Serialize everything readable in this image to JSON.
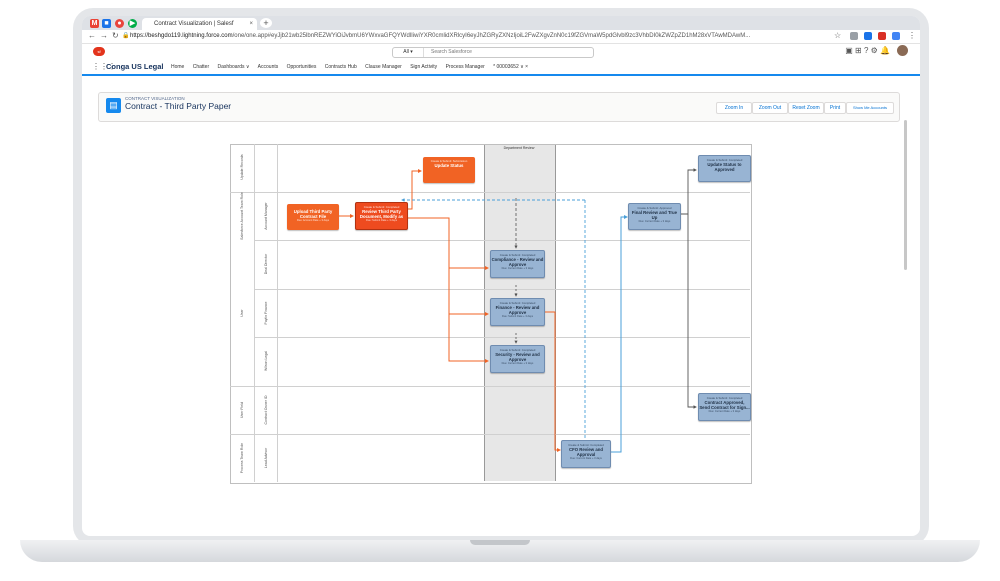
{
  "browser": {
    "tab_title": "Contract Visualization | Salesf",
    "tab_close": "×",
    "new_tab": "+",
    "url_host": "https://beshgdo119.lightning.force.com",
    "url_path": "/one/one.app#eyJjb21wb25lbnREZWYiOiJvbmU6YWxvaGFQYWdlIiwiYXR0cmlidXRlcyI6eyJhZGRyZXNzIjoiL2FwZXgvZnN0c19fZGVmaW5pdGlvbl9zc3VhbDI0kZWZpZD1hM28xVTAwMDAwM..."
  },
  "salesforce": {
    "logo_text": "sf",
    "search_scope": "All ▾",
    "search_placeholder": "Search Salesforce",
    "app_launcher": "⋮⋮⋮",
    "app_name": "Conga US Legal",
    "nav_items": [
      "Home",
      "Chatter",
      "Dashboards ∨",
      "Accounts",
      "Opportunities",
      "Contracts Hub",
      "Clause Manager",
      "Sign Activity",
      "Process Manager",
      "* 00003652 ∨ ×"
    ]
  },
  "page": {
    "record_type": "CONTRACT VISUALIZATION",
    "record_title": "Contract - Third Party Paper",
    "buttons": {
      "zoom_in": "Zoom In",
      "zoom_out": "Zoom Out",
      "reset_zoom": "Reset Zoom",
      "print": "Print",
      "show_accounts": "Show Me Accounts"
    }
  },
  "diagram": {
    "lanes": [
      {
        "label": "Update Records",
        "sub": ""
      },
      {
        "label": "Salesforce Account Team Role",
        "sub": "Account Manager"
      },
      {
        "label": "",
        "sub": "Deal Director"
      },
      {
        "label": "User",
        "sub": "Paylin Finance"
      },
      {
        "label": "",
        "sub": "Wilson Legal"
      },
      {
        "label": "User Field",
        "sub": "Contract Owner ID"
      },
      {
        "label": "Process Team Role",
        "sub": "Lead Advisor"
      }
    ],
    "column_header": "Department Review",
    "tasks": [
      {
        "kind": "Create & Submit: Submission",
        "title": "Update Status",
        "sub": ""
      },
      {
        "kind": "",
        "title": "Upload Third Party Contract File",
        "sub": "Due: Account Date + 3 days"
      },
      {
        "kind": "Create & Submit: Completed",
        "title": "Review Third Party Document, Modify as",
        "sub": "Due: Submit Date + 3 days"
      },
      {
        "kind": "Create & Submit: Completed",
        "title": "Compliance - Review and Approve",
        "sub": "Due: Current Date + 3 days"
      },
      {
        "kind": "Create & Submit: Completed",
        "title": "Finance - Review and Approve",
        "sub": "Due: Submit Date + 3 days"
      },
      {
        "kind": "Create & Submit: Completed",
        "title": "Security - Review and Approve",
        "sub": "Due: Current Date + 3 days"
      },
      {
        "kind": "Create & Submit: Approved",
        "title": "Final Review and True Up",
        "sub": "Due: Current Date + 3 days"
      },
      {
        "kind": "Create & Submit: Completed",
        "title": "Update Status to Approved",
        "sub": ""
      },
      {
        "kind": "Create & Submit: Completed",
        "title": "Contract Approved, Send Contract for Sign...",
        "sub": "Due: Current Date + 3 days"
      },
      {
        "kind": "Create & Submit: Completed",
        "title": "CFO Review and Approval",
        "sub": "Due: Current Date + 3 days"
      }
    ]
  },
  "colors": {
    "accent": "#1589ee",
    "task_orange": "#f16324",
    "task_blue": "#98b4d3",
    "arrow_orange": "#f16324",
    "arrow_blue": "#4a9fd8"
  },
  "icons": [
    "gmail-icon",
    "calendar-icon",
    "chrome-icon",
    "meet-icon",
    "back-icon",
    "forward-icon",
    "reload-icon",
    "lock-icon",
    "bookmark-star-icon",
    "help-icon",
    "gear-icon",
    "bell-icon"
  ]
}
